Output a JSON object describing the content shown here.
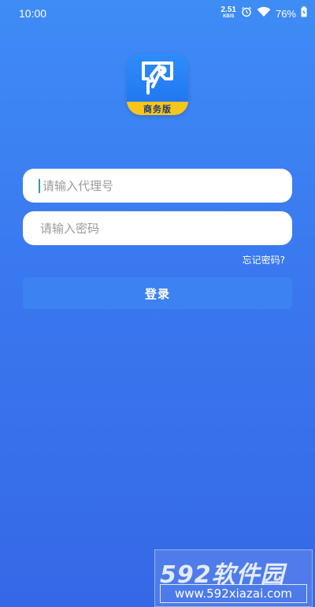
{
  "status_bar": {
    "time": "10:00",
    "net_speed_value": "2.51",
    "net_speed_unit": "KB/S",
    "battery_percent": "76%"
  },
  "app_icon": {
    "badge_label": "商务版",
    "brand_color": "#2f8cfb",
    "badge_color": "#f7c51c"
  },
  "login_form": {
    "agent_placeholder": "请输入代理号",
    "password_placeholder": "请输入密码",
    "forgot_password_label": "忘记密码?",
    "login_button_label": "登录"
  },
  "watermark": {
    "brand": "592软件园",
    "url": "www.592xiazai.com"
  },
  "colors": {
    "background_top": "#3e8cf6",
    "background_bottom": "#3568e6",
    "button": "#3d82f2"
  }
}
